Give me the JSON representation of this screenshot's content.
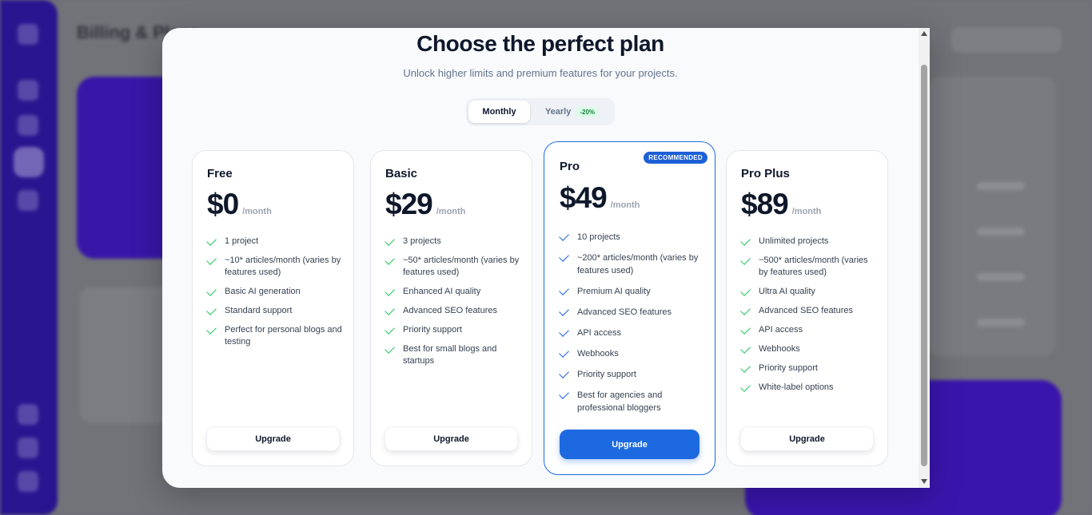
{
  "background": {
    "page_title": "Billing & Plans"
  },
  "modal": {
    "title": "Choose the perfect plan",
    "subtitle": "Unlock higher limits and premium features for your projects.",
    "toggle": {
      "monthly": "Monthly",
      "yearly": "Yearly",
      "yearly_discount": "-20%",
      "selected": "Monthly"
    },
    "plans": [
      {
        "name": "Free",
        "price": "$0",
        "period": "/month",
        "features": [
          "1 project",
          "~10* articles/month (varies by features used)",
          "Basic AI generation",
          "Standard support",
          "Perfect for personal blogs and testing"
        ],
        "button": "Upgrade"
      },
      {
        "name": "Basic",
        "price": "$29",
        "period": "/month",
        "features": [
          "3 projects",
          "~50* articles/month (varies by features used)",
          "Enhanced AI quality",
          "Advanced SEO features",
          "Priority support",
          "Best for small blogs and startups"
        ],
        "button": "Upgrade"
      },
      {
        "name": "Pro",
        "badge": "RECOMMENDED",
        "price": "$49",
        "period": "/month",
        "features": [
          "10 projects",
          "~200* articles/month (varies by features used)",
          "Premium AI quality",
          "Advanced SEO features",
          "API access",
          "Webhooks",
          "Priority support",
          "Best for agencies and professional bloggers"
        ],
        "button": "Upgrade"
      },
      {
        "name": "Pro Plus",
        "price": "$89",
        "period": "/month",
        "features": [
          "Unlimited projects",
          "~500* articles/month (varies by features used)",
          "Ultra AI quality",
          "Advanced SEO features",
          "API access",
          "Webhooks",
          "Priority support",
          "White-label options"
        ],
        "button": "Upgrade"
      }
    ]
  },
  "colors": {
    "accent": "#1d6ae0",
    "check_green": "#22c55e",
    "sidebar": "#2a1590"
  }
}
